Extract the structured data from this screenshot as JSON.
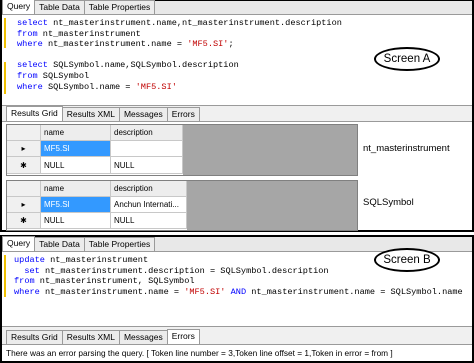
{
  "screen_a": {
    "tabs": [
      "Query",
      "Table Data",
      "Table Properties"
    ],
    "code_lines": [
      [
        {
          "t": "select",
          "c": "kw"
        },
        {
          "t": " nt_masterinstrument.name,nt_masterinstrument.description",
          "c": "txt"
        }
      ],
      [
        {
          "t": "from",
          "c": "kw"
        },
        {
          "t": " nt_masterinstrument",
          "c": "txt"
        }
      ],
      [
        {
          "t": "where",
          "c": "kw"
        },
        {
          "t": " nt_masterinstrument.name = ",
          "c": "txt"
        },
        {
          "t": "'MF5.SI'",
          "c": "str"
        },
        {
          "t": ";",
          "c": "txt"
        }
      ],
      [
        {
          "t": "",
          "c": "txt"
        }
      ],
      [
        {
          "t": "select",
          "c": "kw"
        },
        {
          "t": " SQLSymbol.name,SQLSymbol.description",
          "c": "txt"
        }
      ],
      [
        {
          "t": "from",
          "c": "kw"
        },
        {
          "t": " SQLSymbol",
          "c": "txt"
        }
      ],
      [
        {
          "t": "where",
          "c": "kw"
        },
        {
          "t": " SQLSymbol.name = ",
          "c": "txt"
        },
        {
          "t": "'MF5.SI'",
          "c": "str"
        }
      ]
    ],
    "callout": "Screen A",
    "result_tabs": [
      "Results Grid",
      "Results XML",
      "Messages",
      "Errors"
    ],
    "grid1": {
      "headers": [
        "name",
        "description"
      ],
      "rows": [
        [
          "MF5.SI",
          ""
        ],
        [
          "NULL",
          "NULL"
        ]
      ],
      "row_markers": [
        "▸",
        "✱"
      ],
      "label": "nt_masterinstrument"
    },
    "grid2": {
      "headers": [
        "name",
        "description"
      ],
      "rows": [
        [
          "MF5.SI",
          "Anchun Internati..."
        ],
        [
          "NULL",
          "NULL"
        ]
      ],
      "row_markers": [
        "▸",
        "✱"
      ],
      "label": "SQLSymbol"
    }
  },
  "screen_b": {
    "tabs": [
      "Query",
      "Table Data",
      "Table Properties"
    ],
    "code_lines": [
      [
        {
          "t": "update",
          "c": "kw"
        },
        {
          "t": " nt_masterinstrument",
          "c": "txt"
        }
      ],
      [
        {
          "t": "  set",
          "c": "kw"
        },
        {
          "t": " nt_masterinstrument.description = SQLSymbol.description",
          "c": "txt"
        }
      ],
      [
        {
          "t": "from",
          "c": "kw"
        },
        {
          "t": " nt_masterinstrument, SQLSymbol",
          "c": "txt"
        }
      ],
      [
        {
          "t": "where",
          "c": "kw"
        },
        {
          "t": " nt_masterinstrument.name = ",
          "c": "txt"
        },
        {
          "t": "'MF5.SI'",
          "c": "str"
        },
        {
          "t": " AND",
          "c": "kw"
        },
        {
          "t": " nt_masterinstrument.name = SQLSymbol.name",
          "c": "txt"
        }
      ]
    ],
    "callout": "Screen B",
    "result_tabs": [
      "Results Grid",
      "Results XML",
      "Messages",
      "Errors"
    ],
    "status": "There was an error parsing the query. [ Token line number = 3,Token line offset = 1,Token in error = from ]"
  },
  "colors": {
    "keyword": "#0000ff",
    "string": "#c00000",
    "selection": "#3399ff",
    "grid_empty": "#a6a6a6"
  }
}
